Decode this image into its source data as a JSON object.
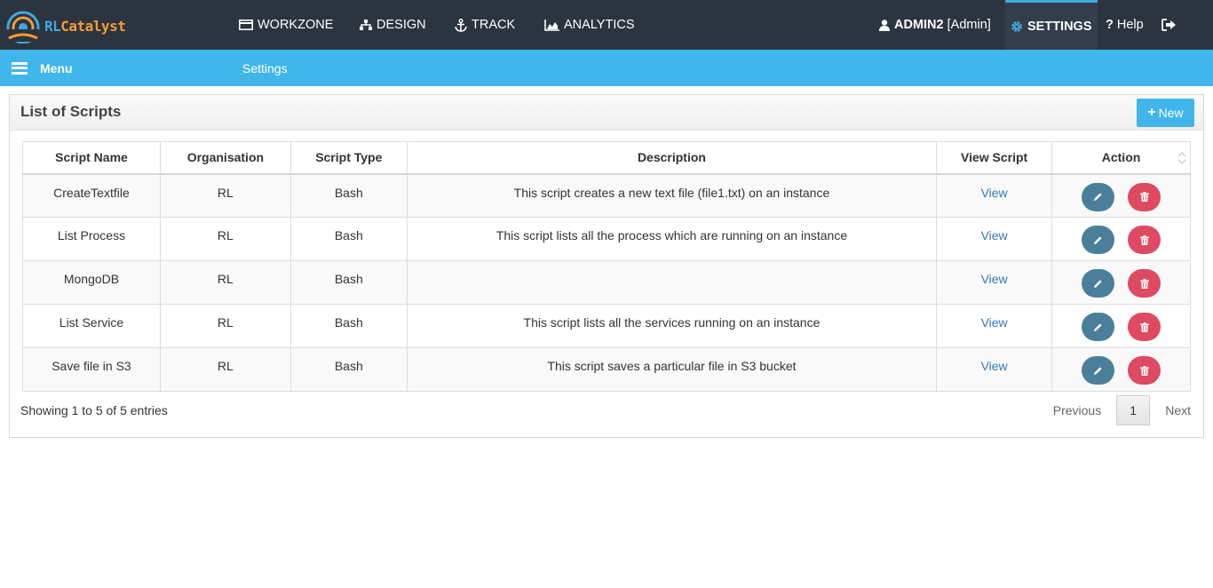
{
  "brand": {
    "part1": "RL",
    "part2": "Catalyst"
  },
  "nav": {
    "items": [
      {
        "label": "WORKZONE",
        "icon": "card-icon"
      },
      {
        "label": "DESIGN",
        "icon": "sitemap-icon"
      },
      {
        "label": "TRACK",
        "icon": "anchor-icon"
      },
      {
        "label": "ANALYTICS",
        "icon": "area-chart-icon"
      }
    ],
    "user": {
      "name": "ADMIN2",
      "role": "[Admin]"
    },
    "settings_label": "SETTINGS",
    "help_label": "Help",
    "logout_icon": "sign-out-icon"
  },
  "subbar": {
    "menu_label": "Menu",
    "breadcrumb": "Settings"
  },
  "panel": {
    "title": "List of Scripts",
    "new_label": "New",
    "columns": [
      "Script Name",
      "Organisation",
      "Script Type",
      "Description",
      "View Script",
      "Action"
    ],
    "rows": [
      {
        "name": "CreateTextfile",
        "org": "RL",
        "type": "Bash",
        "description": "This script creates a new text file (file1.txt) on an instance",
        "view": "View"
      },
      {
        "name": "List Process",
        "org": "RL",
        "type": "Bash",
        "description": "This script lists all the process which are running on an instance",
        "view": "View"
      },
      {
        "name": "MongoDB",
        "org": "RL",
        "type": "Bash",
        "description": "",
        "view": "View"
      },
      {
        "name": "List Service",
        "org": "RL",
        "type": "Bash",
        "description": "This script lists all the services running on an instance",
        "view": "View"
      },
      {
        "name": "Save file in S3",
        "org": "RL",
        "type": "Bash",
        "description": "This script saves a particular file in S3 bucket",
        "view": "View"
      }
    ],
    "footer_info": "Showing 1 to 5 of 5 entries",
    "pager": {
      "previous": "Previous",
      "current": "1",
      "next": "Next"
    }
  },
  "colors": {
    "topbar": "#2c343f",
    "accent": "#41b6ea",
    "edit": "#4a7f9a",
    "delete": "#de4a62",
    "link": "#337ab7"
  }
}
